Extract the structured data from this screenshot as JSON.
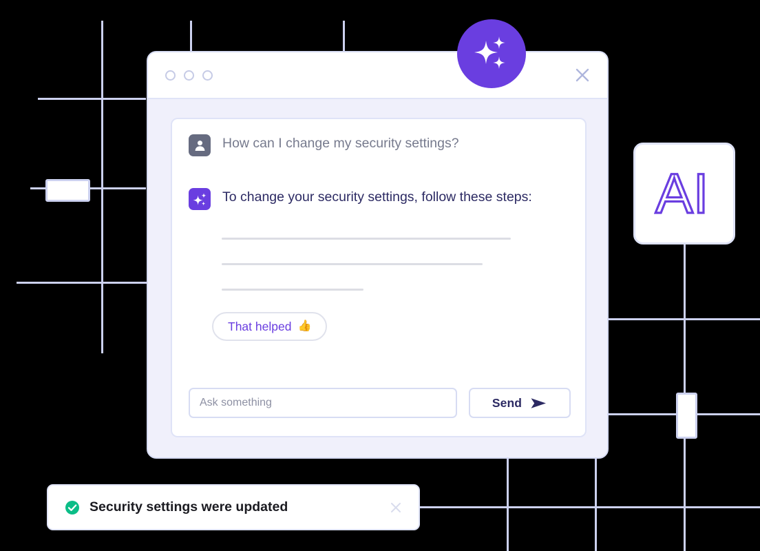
{
  "window": {
    "traffic_dots": [
      "dot-1",
      "dot-2",
      "dot-3"
    ],
    "close_icon": "close-icon",
    "badge_icon": "sparkles-icon"
  },
  "conversation": {
    "messages": [
      {
        "role": "user",
        "avatar_icon": "person-icon",
        "text": "How can I change my security settings?"
      },
      {
        "role": "assistant",
        "avatar_icon": "sparkles-icon",
        "text": "To change your security settings, follow these steps:"
      }
    ],
    "skeleton_lines": [
      420,
      379,
      206
    ],
    "feedback": {
      "label": "That helped",
      "emoji": "👍"
    }
  },
  "composer": {
    "placeholder": "Ask something",
    "value": "",
    "send_label": "Send",
    "send_icon": "send-arrow-icon"
  },
  "toast": {
    "status_icon": "check-circle-icon",
    "message": "Security settings were updated",
    "close_icon": "close-icon"
  },
  "ai_card": {
    "label": "AI",
    "style": "outlined"
  },
  "colors": {
    "accent_purple": "#6a3ee0",
    "grid_line": "#ccd1ef",
    "window_body": "#f0f0fb",
    "border": "#dfe3f7",
    "text_dark": "#2c2a63",
    "text_muted": "#767a8d",
    "success_green": "#0bbd87",
    "skeleton": "#dcdde4",
    "background": "#000000"
  }
}
